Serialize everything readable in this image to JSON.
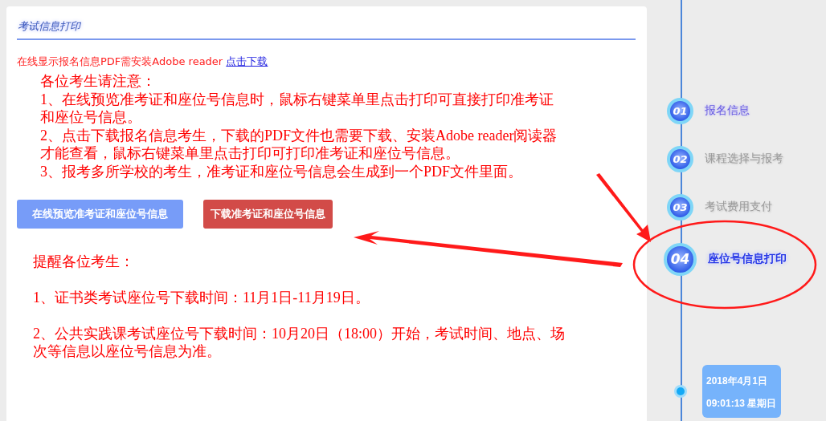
{
  "panel": {
    "title": "考试信息打印",
    "hint": {
      "text": "在线显示报名信息PDF需安装Adobe reader",
      "link": "点击下载"
    },
    "notice_lines": [
      "各位考生请注意：",
      "1、在线预览准考证和座位号信息时，鼠标右键菜单里点击打印可直接打印准考证和座位号信息。",
      "2、点击下载报名信息考生，下载的PDF文件也需要下载、安装Adobe reader阅读器才能查看，鼠标右键菜单里点击打印可打印准考证和座位号信息。",
      "3、报考多所学校的考生，准考证和座位号信息会生成到一个PDF文件里面。"
    ],
    "buttons": [
      {
        "label": "在线预览准考证和座位号信息",
        "kind": "preview"
      },
      {
        "label": "下载准考证和座位号信息",
        "kind": "download"
      }
    ],
    "reminder_title": "提醒各位考生：",
    "reminder_lines": [
      "1、证书类考试座位号下载时间：11月1日-11月19日。",
      "2、公共实践课考试座位号下载时间：10月20日（18:00）开始，考试时间、地点、场次等信息以座位号信息为准。"
    ]
  },
  "steps": [
    {
      "number": "01",
      "label": "报名信息",
      "completed": true,
      "current": false
    },
    {
      "number": "02",
      "label": "课程选择与报考",
      "completed": false,
      "current": false
    },
    {
      "number": "03",
      "label": "考试费用支付",
      "completed": false,
      "current": false
    },
    {
      "number": "04",
      "label": "座位号信息打印",
      "completed": false,
      "current": true
    }
  ],
  "clock": {
    "date": "2018年4月1日",
    "time": "09:01:13 星期日"
  }
}
